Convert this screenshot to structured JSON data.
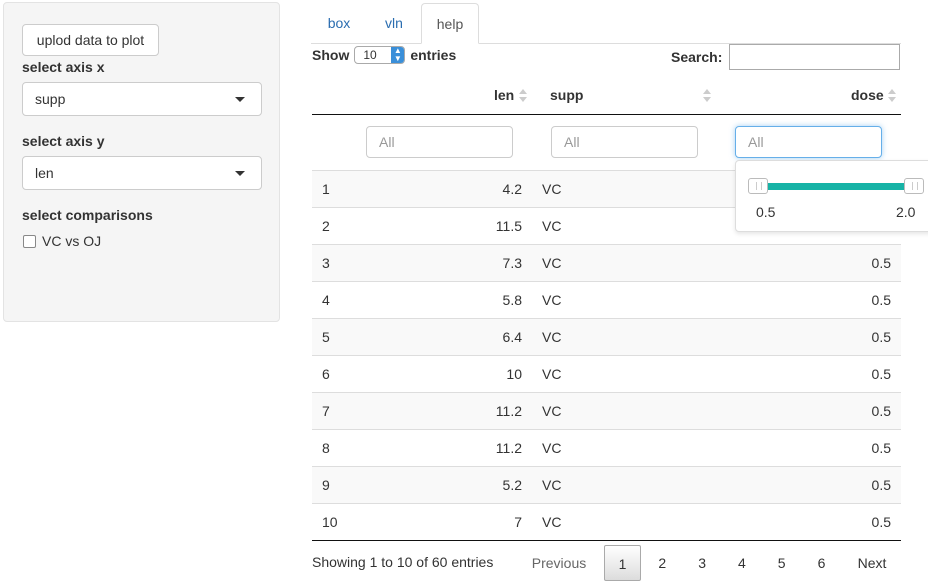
{
  "sidebar": {
    "upload_button": "uplod data to plot",
    "axis_x_label": "select axis x",
    "axis_x_value": "supp",
    "axis_y_label": "select axis y",
    "axis_y_value": "len",
    "comparisons_label": "select comparisons",
    "comparison_option": "VC vs OJ"
  },
  "tabs": [
    "box",
    "vln",
    "help"
  ],
  "table_controls": {
    "show_label": "Show",
    "entries_value": "10",
    "entries_label": "entries",
    "search_label": "Search:"
  },
  "columns": [
    "len",
    "supp",
    "dose"
  ],
  "filter_placeholder": "All",
  "dose_slider": {
    "min": "0.5",
    "max": "2.0"
  },
  "rows": [
    {
      "idx": "1",
      "len": "4.2",
      "supp": "VC",
      "dose": ""
    },
    {
      "idx": "2",
      "len": "11.5",
      "supp": "VC",
      "dose": ""
    },
    {
      "idx": "3",
      "len": "7.3",
      "supp": "VC",
      "dose": "0.5"
    },
    {
      "idx": "4",
      "len": "5.8",
      "supp": "VC",
      "dose": "0.5"
    },
    {
      "idx": "5",
      "len": "6.4",
      "supp": "VC",
      "dose": "0.5"
    },
    {
      "idx": "6",
      "len": "10",
      "supp": "VC",
      "dose": "0.5"
    },
    {
      "idx": "7",
      "len": "11.2",
      "supp": "VC",
      "dose": "0.5"
    },
    {
      "idx": "8",
      "len": "11.2",
      "supp": "VC",
      "dose": "0.5"
    },
    {
      "idx": "9",
      "len": "5.2",
      "supp": "VC",
      "dose": "0.5"
    },
    {
      "idx": "10",
      "len": "7",
      "supp": "VC",
      "dose": "0.5"
    }
  ],
  "footer": {
    "info": "Showing 1 to 10 of 60 entries",
    "previous": "Previous",
    "next": "Next",
    "pages": [
      "1",
      "2",
      "3",
      "4",
      "5",
      "6"
    ]
  }
}
